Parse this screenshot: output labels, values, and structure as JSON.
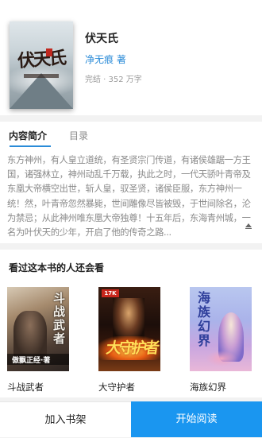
{
  "book": {
    "title": "伏天氏",
    "author": "净无痕 著",
    "status": "完结 · 352 万字",
    "cover_title": "伏天氏"
  },
  "intro": {
    "tab_active": "内容简介",
    "tab_other": "目录",
    "text": "东方神州，有人皇立道统，有圣贤宗门传道，有诸侯雄踞一方王国，诸强林立，神州动乱千万载，执此之时，一代天骄叶青帝及东凰大帝横空出世，斩人皇，驭圣贤，诸侯臣服，东方神州一统！然，叶青帝忽然暴毙，世间雕像尽皆被毁，于世间除名，沦为禁忌；从此神州唯东凰大帝独尊！十五年后，东海青州城，一名为叶伏天的少年，开启了他的传奇之路..."
  },
  "recommend": {
    "title": "看过这本书的人还会看",
    "items": [
      {
        "name": "斗战武者",
        "cover_vertical": "斗战武者",
        "cover_band": "傲飘正经·著"
      },
      {
        "name": "大守护者",
        "cover_logo": "17K",
        "cover_title": "大守护者"
      },
      {
        "name": "海族幻界",
        "cover_vertical": "海族幻界"
      }
    ]
  },
  "actions": {
    "add_shelf": "加入书架",
    "start_read": "开始阅读"
  }
}
